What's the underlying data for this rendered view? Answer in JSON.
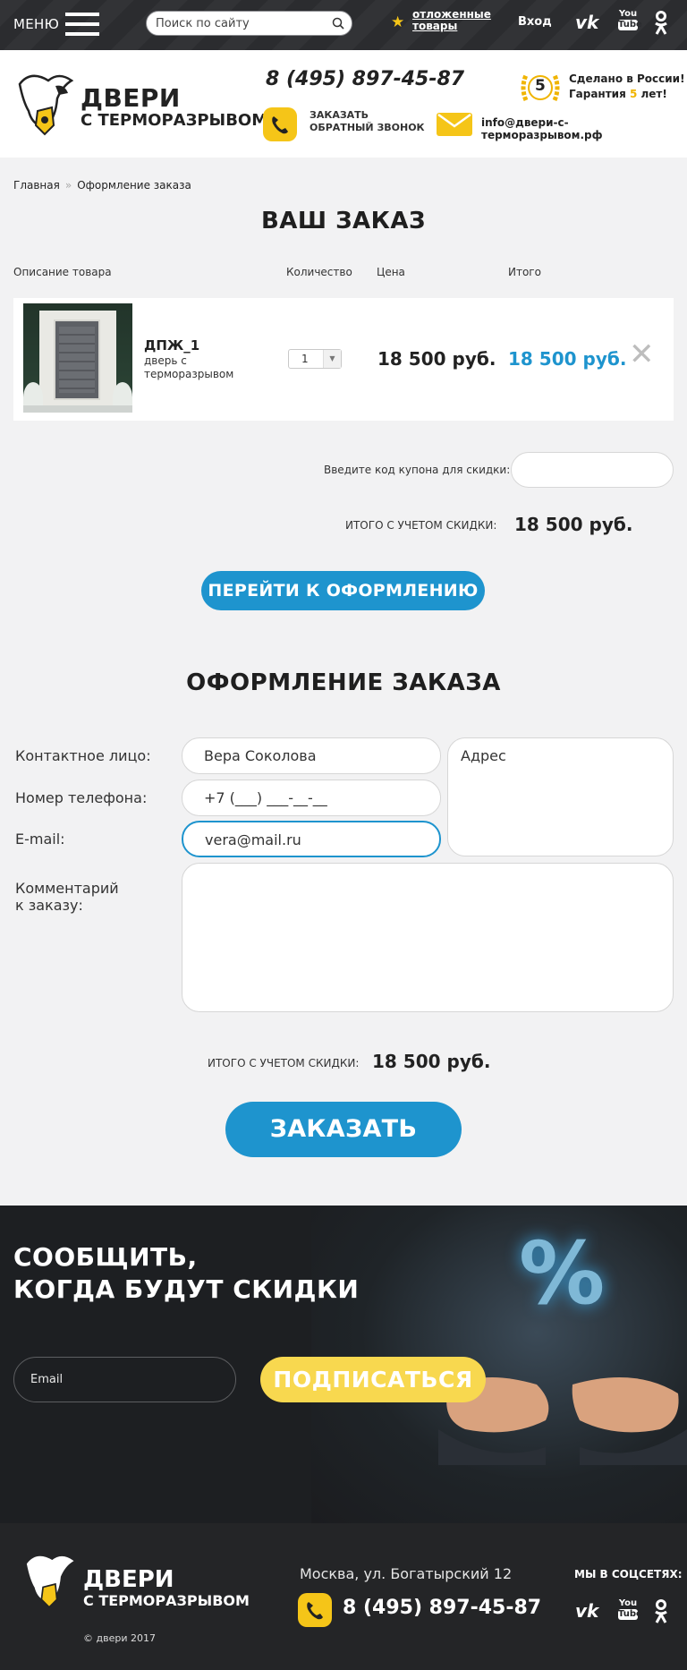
{
  "topbar": {
    "menu_label": "МЕНЮ",
    "search_placeholder": "Поиск по сайту",
    "saved_line1": "отложенные",
    "saved_line2": "товары",
    "login": "Вход",
    "social": {
      "vk": "vk",
      "youtube_top": "You",
      "youtube_bottom": "Tube",
      "ok": "ok"
    }
  },
  "header": {
    "logo_line1": "ДВЕРИ",
    "logo_line2": "С ТЕРМОРАЗРЫВОМ",
    "phone": "8 (495) 897-45-87",
    "callback_line1": "ЗАКАЗАТЬ",
    "callback_line2": "ОБРАТНЫЙ ЗВОНОК",
    "medal_number": "5",
    "made_line1": "Сделано в России!",
    "made_line2_pre": "Гарантия ",
    "made_line2_num": "5",
    "made_line2_post": " лет!",
    "email": "info@двери-с-терморазрывом.рф"
  },
  "breadcrumb": [
    "Главная",
    "Оформление заказа"
  ],
  "cart": {
    "title": "ВАШ ЗАКАЗ",
    "columns": [
      "Описание товара",
      "Количество",
      "Цена",
      "Итого"
    ],
    "item": {
      "name": "ДПЖ_1",
      "desc": "дверь с терморазрывом",
      "qty": "1",
      "price": "18 500 руб.",
      "total": "18 500 руб.",
      "remove": "✕"
    },
    "coupon_label": "Введите код купона для скидки:",
    "coupon_value": "",
    "discount_label": "ИТОГО С УЧЕТОМ СКИДКИ:",
    "discount_sum": "18 500 руб.",
    "checkout_button": "ПЕРЕЙТИ К ОФОРМЛЕНИЮ"
  },
  "checkout": {
    "title": "ОФОРМЛЕНИЕ ЗАКАЗА",
    "contact_label": "Контактное лицо:",
    "contact_value": "Вера Соколова",
    "phone_label": "Номер телефона:",
    "phone_value": "+7  (___)  ___-__-__",
    "email_label": "E-mail:",
    "email_value": "vera@mail.ru",
    "address_placeholder": "Адрес",
    "comment_label_line1": "Комментарий",
    "comment_label_line2": "к заказу:",
    "discount_label": "ИТОГО С УЧЕТОМ СКИДКИ:",
    "discount_sum": "18 500 руб.",
    "order_button": "ЗАКАЗАТЬ"
  },
  "subscribe": {
    "title_line1": "СООБЩИТЬ,",
    "title_line2": "КОГДА БУДУТ СКИДКИ",
    "email_placeholder": "Email",
    "button": "ПОДПИСАТЬСЯ",
    "percent": "%"
  },
  "footer": {
    "logo_line1": "ДВЕРИ",
    "logo_line2": "С ТЕРМОРАЗРЫВОМ",
    "copyright": "© двери 2017",
    "address": "Москва, ул. Богатырский 12",
    "phone": "8 (495) 897-45-87",
    "social_title": "МЫ В СОЦСЕТЯХ:"
  },
  "colors": {
    "accent_blue": "#1e94ce",
    "accent_yellow": "#f5c518",
    "dark": "#2b2c2f"
  }
}
